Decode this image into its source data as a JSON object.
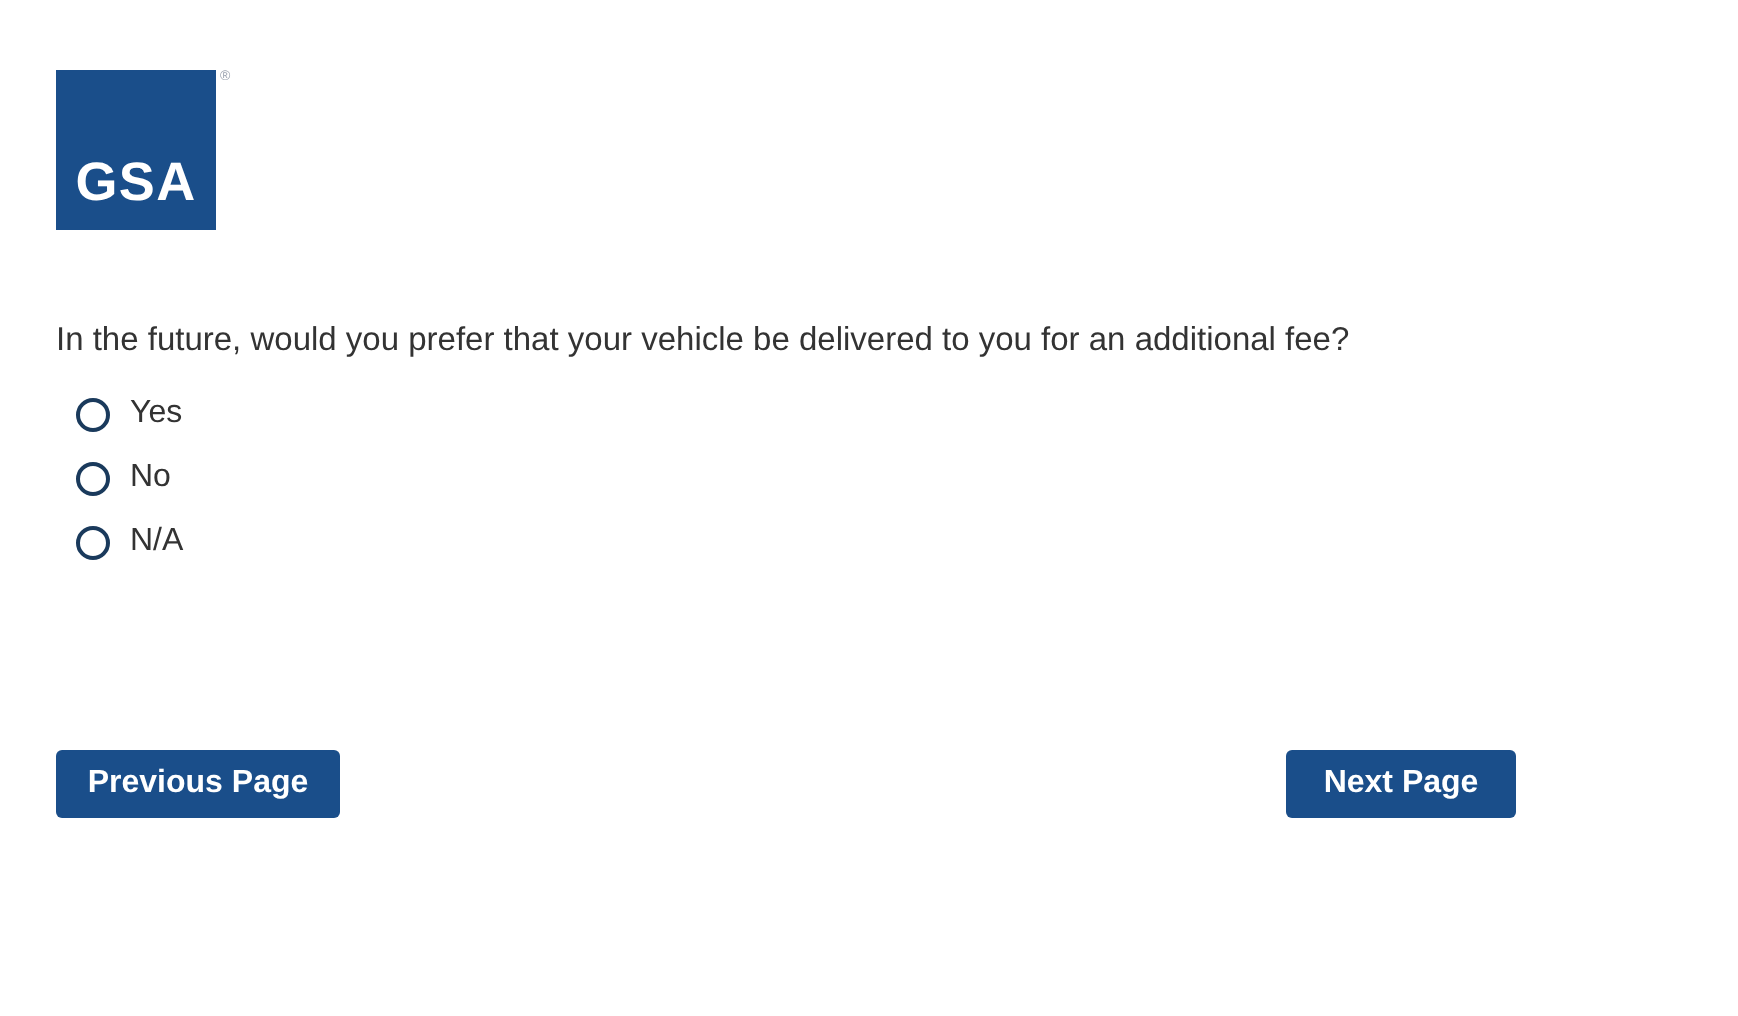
{
  "logo": {
    "text": "GSA",
    "mark": "®"
  },
  "question": "In the future, would you prefer that your vehicle be delivered to you for an additional fee?",
  "options": [
    {
      "label": "Yes",
      "selected": false
    },
    {
      "label": "No",
      "selected": false
    },
    {
      "label": "N/A",
      "selected": false
    }
  ],
  "buttons": {
    "previous": "Previous Page",
    "next": "Next Page"
  }
}
